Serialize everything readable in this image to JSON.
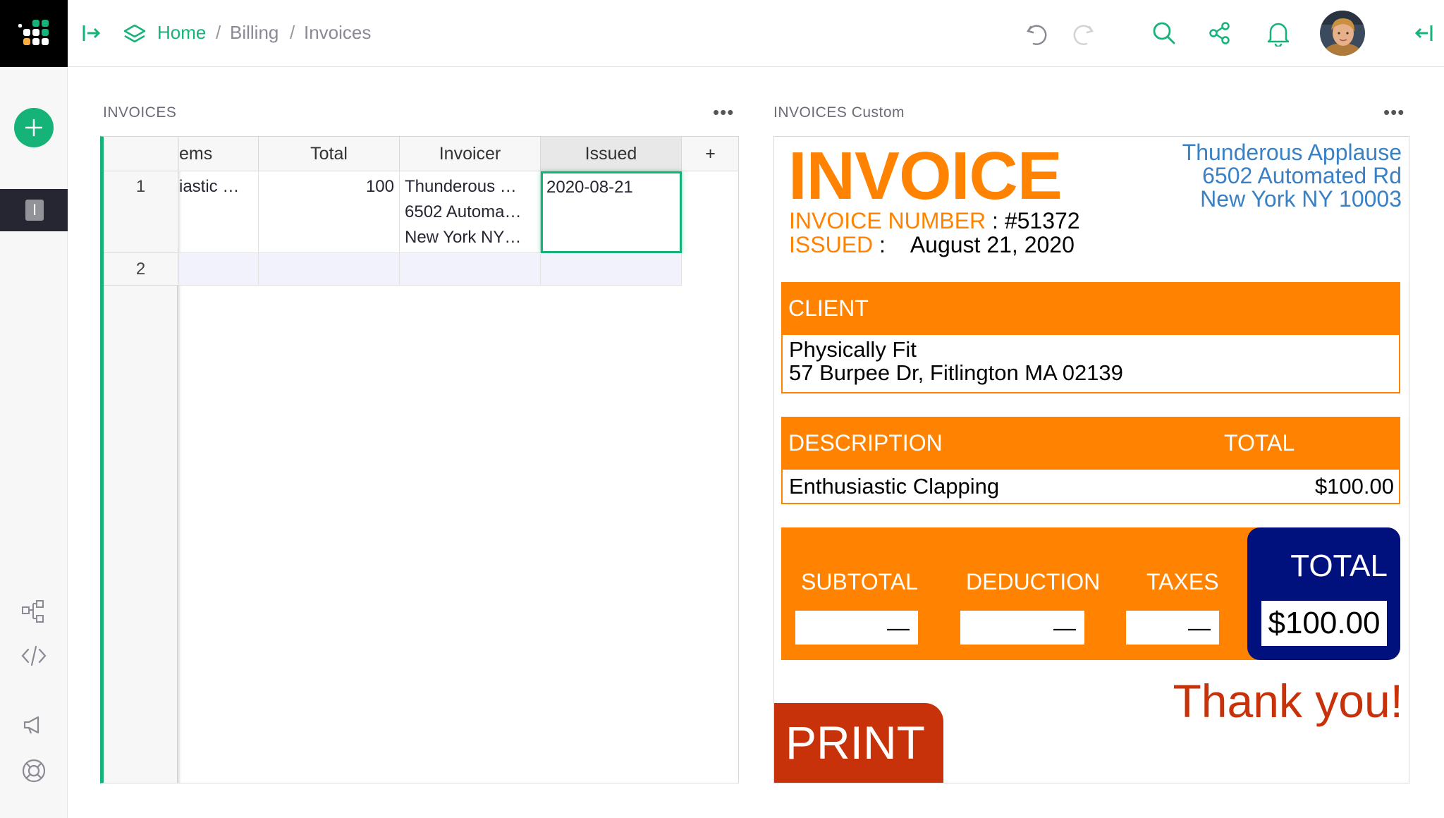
{
  "breadcrumb": {
    "home": "Home",
    "sep1": "/",
    "billing": "Billing",
    "sep2": "/",
    "current": "Invoices"
  },
  "leftnav": {
    "page_badge": "I"
  },
  "grid_section": {
    "title": "INVOICES",
    "more": "•••",
    "columns": [
      "ems",
      "Total",
      "Invoicer",
      "Issued",
      "+"
    ],
    "rows": [
      {
        "num": "1",
        "items": "iastic …",
        "total": "100",
        "invoicer": [
          "Thunderous …",
          "6502 Automa…",
          "New York NY…"
        ],
        "issued": "2020-08-21"
      },
      {
        "num": "2",
        "items": "",
        "total": "",
        "invoicer": [
          "",
          "",
          ""
        ],
        "issued": ""
      }
    ]
  },
  "invoice_section": {
    "title": "INVOICES Custom",
    "more": "•••",
    "heading": "INVOICE",
    "invoicer": {
      "line1": "Thunderous Applause",
      "line2": "6502 Automated Rd",
      "line3": "New York NY 10003"
    },
    "number_label": "INVOICE NUMBER",
    "number_value": ": #51372",
    "issued_label": "ISSUED",
    "issued_sep": ":",
    "issued_value": "August 21, 2020",
    "client": {
      "header": "CLIENT",
      "name": "Physically Fit",
      "address": "57 Burpee Dr, Fitlington MA 02139"
    },
    "items": {
      "desc_header": "DESCRIPTION",
      "total_header": "TOTAL",
      "desc": "Enthusiastic Clapping",
      "amount": "$100.00"
    },
    "summary": {
      "subtotal_label": "SUBTOTAL",
      "subtotal_value": "—",
      "deduction_label": "DEDUCTION",
      "deduction_value": "—",
      "taxes_label": "TAXES",
      "taxes_value": "—",
      "total_label": "TOTAL",
      "total_value": "$100.00"
    },
    "thanks": "Thank you!",
    "print": "PRINT"
  },
  "colors": {
    "accent": "#16b378",
    "orange": "#ff8200",
    "navy": "#00117e",
    "print_red": "#c7320a"
  }
}
